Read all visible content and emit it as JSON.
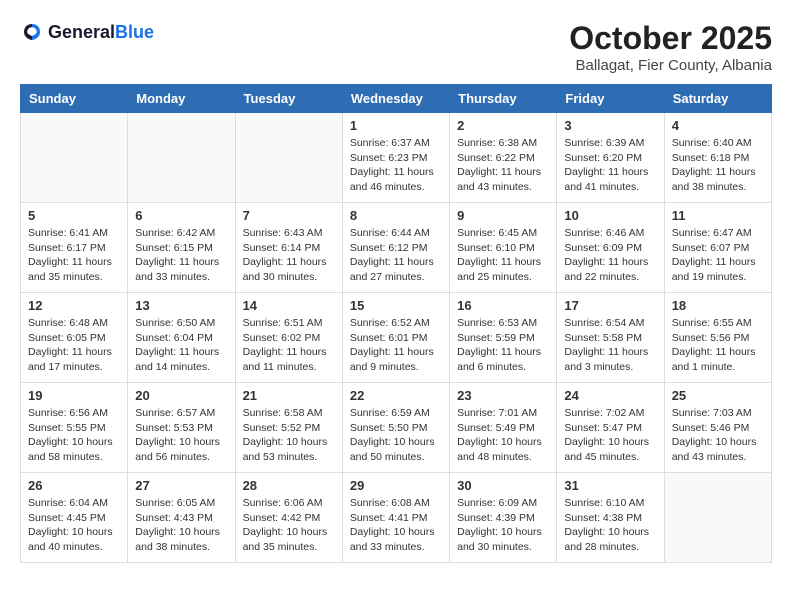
{
  "header": {
    "logo_general": "General",
    "logo_blue": "Blue",
    "month": "October 2025",
    "location": "Ballagat, Fier County, Albania"
  },
  "weekdays": [
    "Sunday",
    "Monday",
    "Tuesday",
    "Wednesday",
    "Thursday",
    "Friday",
    "Saturday"
  ],
  "weeks": [
    [
      {
        "day": "",
        "info": ""
      },
      {
        "day": "",
        "info": ""
      },
      {
        "day": "",
        "info": ""
      },
      {
        "day": "1",
        "info": "Sunrise: 6:37 AM\nSunset: 6:23 PM\nDaylight: 11 hours\nand 46 minutes."
      },
      {
        "day": "2",
        "info": "Sunrise: 6:38 AM\nSunset: 6:22 PM\nDaylight: 11 hours\nand 43 minutes."
      },
      {
        "day": "3",
        "info": "Sunrise: 6:39 AM\nSunset: 6:20 PM\nDaylight: 11 hours\nand 41 minutes."
      },
      {
        "day": "4",
        "info": "Sunrise: 6:40 AM\nSunset: 6:18 PM\nDaylight: 11 hours\nand 38 minutes."
      }
    ],
    [
      {
        "day": "5",
        "info": "Sunrise: 6:41 AM\nSunset: 6:17 PM\nDaylight: 11 hours\nand 35 minutes."
      },
      {
        "day": "6",
        "info": "Sunrise: 6:42 AM\nSunset: 6:15 PM\nDaylight: 11 hours\nand 33 minutes."
      },
      {
        "day": "7",
        "info": "Sunrise: 6:43 AM\nSunset: 6:14 PM\nDaylight: 11 hours\nand 30 minutes."
      },
      {
        "day": "8",
        "info": "Sunrise: 6:44 AM\nSunset: 6:12 PM\nDaylight: 11 hours\nand 27 minutes."
      },
      {
        "day": "9",
        "info": "Sunrise: 6:45 AM\nSunset: 6:10 PM\nDaylight: 11 hours\nand 25 minutes."
      },
      {
        "day": "10",
        "info": "Sunrise: 6:46 AM\nSunset: 6:09 PM\nDaylight: 11 hours\nand 22 minutes."
      },
      {
        "day": "11",
        "info": "Sunrise: 6:47 AM\nSunset: 6:07 PM\nDaylight: 11 hours\nand 19 minutes."
      }
    ],
    [
      {
        "day": "12",
        "info": "Sunrise: 6:48 AM\nSunset: 6:05 PM\nDaylight: 11 hours\nand 17 minutes."
      },
      {
        "day": "13",
        "info": "Sunrise: 6:50 AM\nSunset: 6:04 PM\nDaylight: 11 hours\nand 14 minutes."
      },
      {
        "day": "14",
        "info": "Sunrise: 6:51 AM\nSunset: 6:02 PM\nDaylight: 11 hours\nand 11 minutes."
      },
      {
        "day": "15",
        "info": "Sunrise: 6:52 AM\nSunset: 6:01 PM\nDaylight: 11 hours\nand 9 minutes."
      },
      {
        "day": "16",
        "info": "Sunrise: 6:53 AM\nSunset: 5:59 PM\nDaylight: 11 hours\nand 6 minutes."
      },
      {
        "day": "17",
        "info": "Sunrise: 6:54 AM\nSunset: 5:58 PM\nDaylight: 11 hours\nand 3 minutes."
      },
      {
        "day": "18",
        "info": "Sunrise: 6:55 AM\nSunset: 5:56 PM\nDaylight: 11 hours\nand 1 minute."
      }
    ],
    [
      {
        "day": "19",
        "info": "Sunrise: 6:56 AM\nSunset: 5:55 PM\nDaylight: 10 hours\nand 58 minutes."
      },
      {
        "day": "20",
        "info": "Sunrise: 6:57 AM\nSunset: 5:53 PM\nDaylight: 10 hours\nand 56 minutes."
      },
      {
        "day": "21",
        "info": "Sunrise: 6:58 AM\nSunset: 5:52 PM\nDaylight: 10 hours\nand 53 minutes."
      },
      {
        "day": "22",
        "info": "Sunrise: 6:59 AM\nSunset: 5:50 PM\nDaylight: 10 hours\nand 50 minutes."
      },
      {
        "day": "23",
        "info": "Sunrise: 7:01 AM\nSunset: 5:49 PM\nDaylight: 10 hours\nand 48 minutes."
      },
      {
        "day": "24",
        "info": "Sunrise: 7:02 AM\nSunset: 5:47 PM\nDaylight: 10 hours\nand 45 minutes."
      },
      {
        "day": "25",
        "info": "Sunrise: 7:03 AM\nSunset: 5:46 PM\nDaylight: 10 hours\nand 43 minutes."
      }
    ],
    [
      {
        "day": "26",
        "info": "Sunrise: 6:04 AM\nSunset: 4:45 PM\nDaylight: 10 hours\nand 40 minutes."
      },
      {
        "day": "27",
        "info": "Sunrise: 6:05 AM\nSunset: 4:43 PM\nDaylight: 10 hours\nand 38 minutes."
      },
      {
        "day": "28",
        "info": "Sunrise: 6:06 AM\nSunset: 4:42 PM\nDaylight: 10 hours\nand 35 minutes."
      },
      {
        "day": "29",
        "info": "Sunrise: 6:08 AM\nSunset: 4:41 PM\nDaylight: 10 hours\nand 33 minutes."
      },
      {
        "day": "30",
        "info": "Sunrise: 6:09 AM\nSunset: 4:39 PM\nDaylight: 10 hours\nand 30 minutes."
      },
      {
        "day": "31",
        "info": "Sunrise: 6:10 AM\nSunset: 4:38 PM\nDaylight: 10 hours\nand 28 minutes."
      },
      {
        "day": "",
        "info": ""
      }
    ]
  ]
}
